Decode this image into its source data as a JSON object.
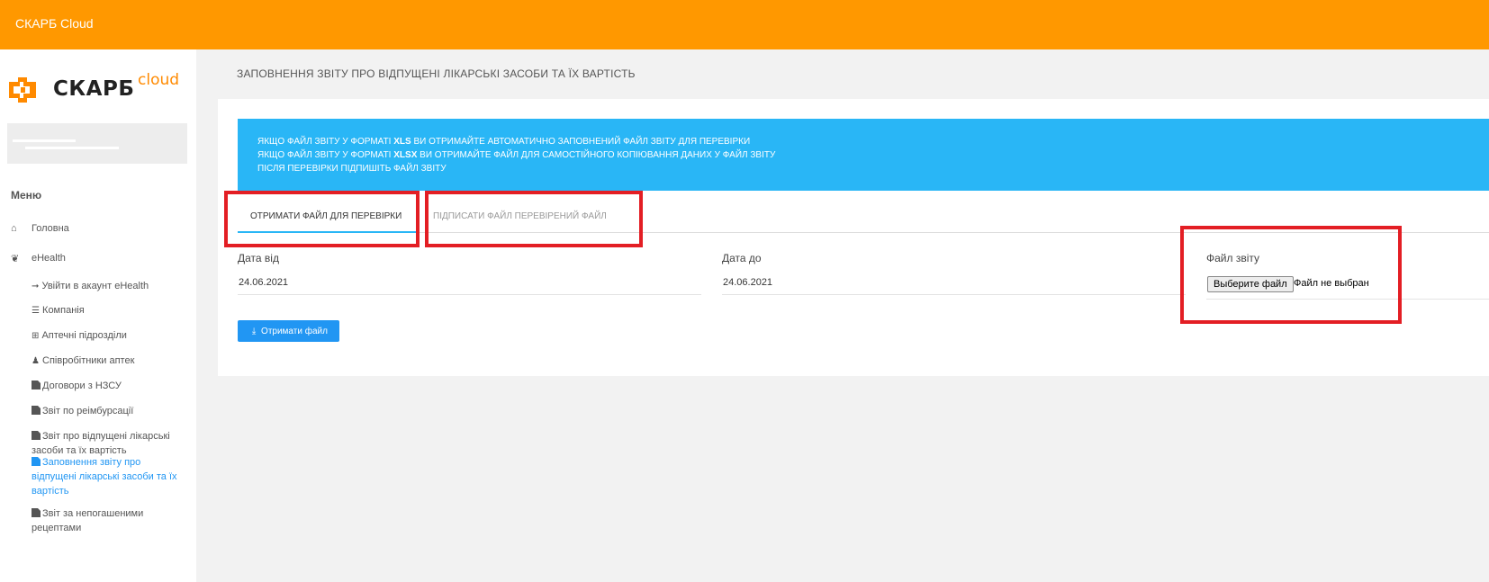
{
  "app": {
    "title": "СКАРБ Cloud",
    "accent_color": "#ff9800",
    "highlight_color": "#e31e24",
    "info_color": "#29b6f6",
    "button_color": "#2196f3"
  },
  "sidebar": {
    "logo": {
      "word": "СКАРБ",
      "suffix": "cloud",
      "icon": "skarb-logo-icon"
    },
    "menu_title": "Меню",
    "items": [
      {
        "label": "Головна",
        "icon": "home-icon"
      },
      {
        "label": "eHealth",
        "icon": "leaf-icon"
      }
    ],
    "subitems": [
      {
        "label": "Увійти в акаунт eHealth",
        "icon": "sign-in-icon"
      },
      {
        "label": "Компанія",
        "icon": "database-icon"
      },
      {
        "label": "Аптечні підрозділи",
        "icon": "plus-square-icon"
      },
      {
        "label": "Співробітники аптек",
        "icon": "user-md-icon"
      },
      {
        "label": "Договори з НЗСУ",
        "icon": "file-icon"
      },
      {
        "label": "Звіт по реімбурсації",
        "icon": "file-icon"
      },
      {
        "label_line1": "Звіт про відпущені лікарські",
        "label_line2": "засоби та їх вартість",
        "icon": "file-icon"
      },
      {
        "label_line1": "Заповнення звіту про",
        "label_line2": "відпущені лікарські засоби та їх",
        "label_line3": "вартість",
        "icon": "file-icon",
        "active": true
      },
      {
        "label_line1": "Звіт за непогашеними",
        "label_line2": "рецептами",
        "icon": "file-icon"
      }
    ]
  },
  "main": {
    "page_title": "ЗАПОВНЕННЯ ЗВІТУ ПРО ВІДПУЩЕНІ ЛІКАРСЬКІ ЗАСОБИ ТА ЇХ ВАРТІСТЬ",
    "info_lines": [
      {
        "pre": "ЯКЩО ФАЙЛ ЗВІТУ У ФОРМАТІ ",
        "bold": "XLS",
        "post": " ВИ ОТРИМАЙТЕ АВТОМАТИЧНО ЗАПОВНЕНИЙ ФАЙЛ ЗВІТУ ДЛЯ ПЕРЕВІРКИ"
      },
      {
        "pre": "ЯКЩО ФАЙЛ ЗВІТУ У ФОРМАТІ ",
        "bold": "XLSX",
        "post": " ВИ ОТРИМАЙТЕ ФАЙЛ ДЛЯ САМОСТІЙНОГО КОПІЮВАННЯ ДАНИХ У ФАЙЛ ЗВІТУ"
      },
      {
        "pre": "ПІСЛЯ ПЕРЕВІРКИ ПІДПИШІТЬ ФАЙЛ ЗВІТУ",
        "bold": "",
        "post": ""
      }
    ],
    "tabs": [
      {
        "label": "ОТРИМАТИ ФАЙЛ ДЛЯ ПЕРЕВІРКИ",
        "active": true
      },
      {
        "label": "ПІДПИСАТИ ФАЙЛ ПЕРЕВІРЕНИЙ ФАЙЛ",
        "active": false
      }
    ],
    "date_from": {
      "label": "Дата від",
      "value": "24.06.2021"
    },
    "date_to": {
      "label": "Дата до",
      "value": "24.06.2021"
    },
    "report_file": {
      "label": "Файл звіту",
      "button": "Выберите файл",
      "status": "Файл не выбран"
    },
    "get_file_button": {
      "label": "Отримати файл",
      "icon": "download-icon"
    }
  }
}
